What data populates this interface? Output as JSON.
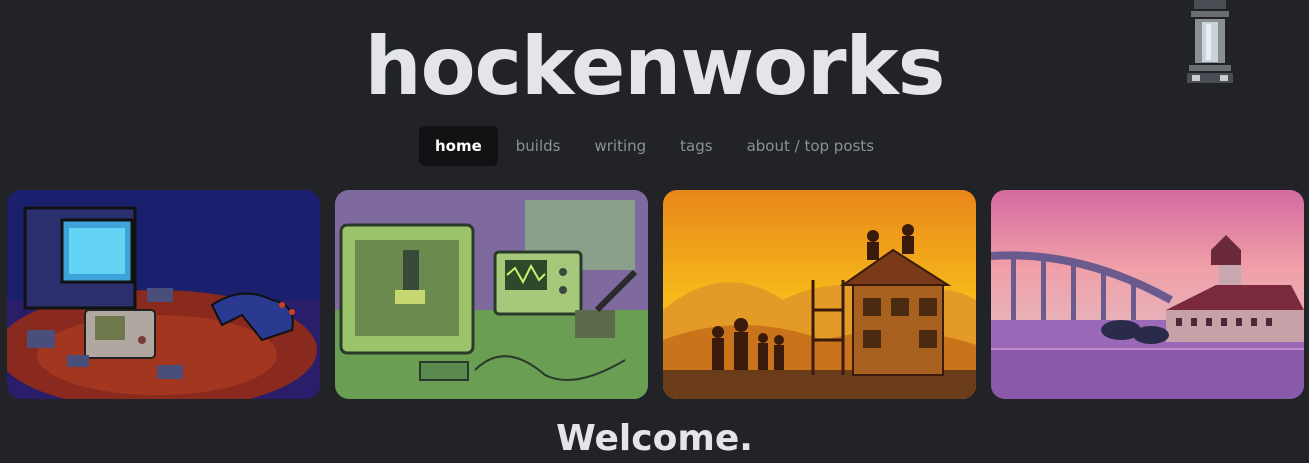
{
  "site": {
    "title": "hockenworks"
  },
  "nav": {
    "items": [
      {
        "label": "home",
        "active": true
      },
      {
        "label": "builds",
        "active": false
      },
      {
        "label": "writing",
        "active": false
      },
      {
        "label": "tags",
        "active": false
      },
      {
        "label": "about / top posts",
        "active": false
      }
    ]
  },
  "tiles": [
    {
      "icon": "retro-gaming-scene-image"
    },
    {
      "icon": "electronics-workbench-image"
    },
    {
      "icon": "house-building-family-image"
    },
    {
      "icon": "coastal-hotel-bridge-image"
    }
  ],
  "main": {
    "heading": "Welcome."
  }
}
